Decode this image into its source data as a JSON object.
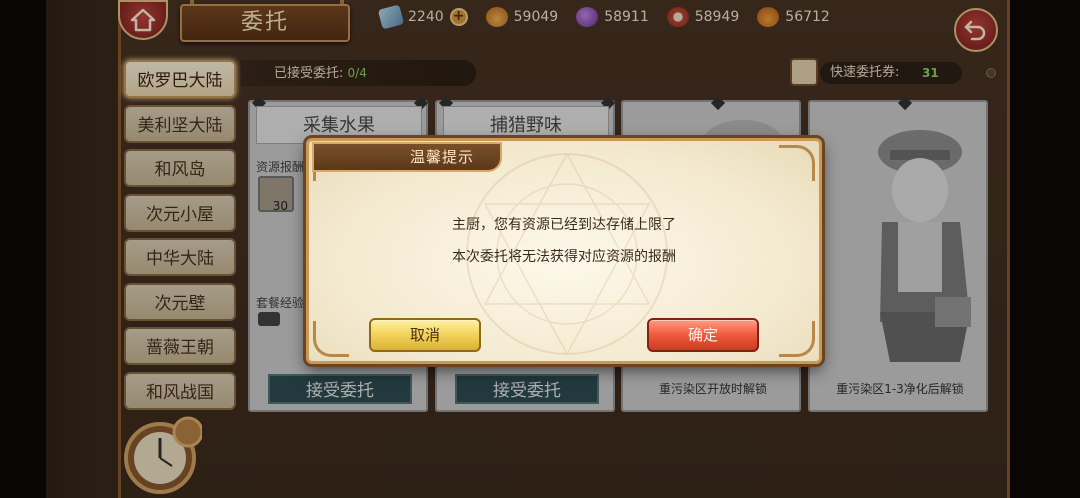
{
  "header": {
    "title": "委托"
  },
  "resources": [
    {
      "name": "crystal",
      "icon": "crystal-icon",
      "value": "2240",
      "color": "#7fa7c7",
      "has_plus": true
    },
    {
      "name": "potion",
      "icon": "potion-icon",
      "value": "59049",
      "color": "#e79a3b"
    },
    {
      "name": "gem",
      "icon": "gem-icon",
      "value": "58911",
      "color": "#9b59c7"
    },
    {
      "name": "meat",
      "icon": "meat-icon",
      "value": "58949",
      "color": "#c7503d"
    },
    {
      "name": "fruit",
      "icon": "fruit-icon",
      "value": "56712",
      "color": "#d8892f"
    }
  ],
  "subheader": {
    "accepted_label": "已接受委托:",
    "accepted_count": "0/4",
    "quick_label": "快速委托券:",
    "quick_value": "31"
  },
  "regions": [
    {
      "label": "欧罗巴大陆",
      "active": true
    },
    {
      "label": "美利坚大陆",
      "active": false
    },
    {
      "label": "和风岛",
      "active": false
    },
    {
      "label": "次元小屋",
      "active": false
    },
    {
      "label": "中华大陆",
      "active": false
    },
    {
      "label": "次元壁",
      "active": false
    },
    {
      "label": "蔷薇王朝",
      "active": false
    },
    {
      "label": "和风战国",
      "active": false
    }
  ],
  "cards": [
    {
      "title": "采集水果",
      "reward_label": "资源报酬",
      "reward_value": "30",
      "exp_label": "套餐经验",
      "action": "接受委托"
    },
    {
      "title": "捕猎野味",
      "action": "接受委托"
    },
    {
      "lock_text": "重污染区开放时解锁"
    },
    {
      "lock_text": "重污染区1-3净化后解锁"
    }
  ],
  "dialog": {
    "title": "温馨提示",
    "line1": "主厨，您有资源已经到达存储上限了",
    "line2": "本次委托将无法获得对应资源的报酬",
    "cancel": "取消",
    "confirm": "确定"
  }
}
